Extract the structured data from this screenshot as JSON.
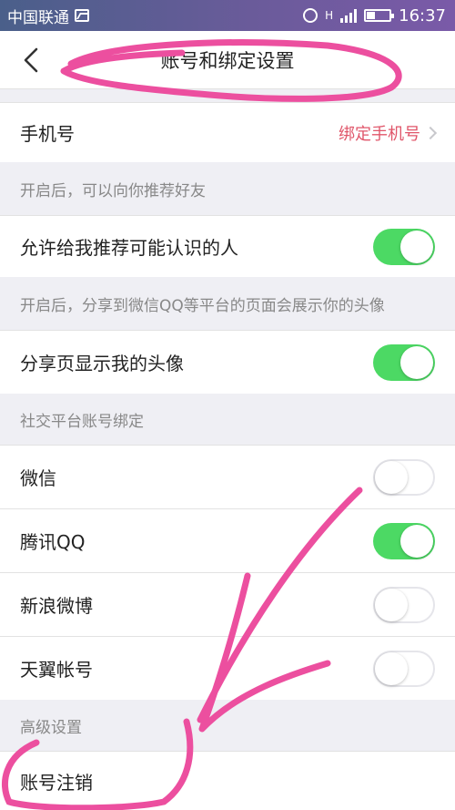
{
  "status_bar": {
    "carrier": "中国联通",
    "time": "16:37",
    "network": "H"
  },
  "nav": {
    "title": "账号和绑定设置"
  },
  "phone": {
    "label": "手机号",
    "value": "绑定手机号"
  },
  "recommend": {
    "hint": "开启后，可以向你推荐好友",
    "label": "允许给我推荐可能认识的人",
    "enabled": true
  },
  "avatar": {
    "hint": "开启后，分享到微信QQ等平台的页面会展示你的头像",
    "label": "分享页显示我的头像",
    "enabled": true
  },
  "social": {
    "header": "社交平台账号绑定",
    "items": [
      {
        "label": "微信",
        "enabled": false
      },
      {
        "label": "腾讯QQ",
        "enabled": true
      },
      {
        "label": "新浪微博",
        "enabled": false
      },
      {
        "label": "天翼帐号",
        "enabled": false
      }
    ]
  },
  "advanced": {
    "header": "高级设置",
    "cancel_label": "账号注销"
  },
  "colors": {
    "toggle_on": "#4cd964",
    "accent": "#e0566a",
    "annotation": "#ec4f9f"
  }
}
